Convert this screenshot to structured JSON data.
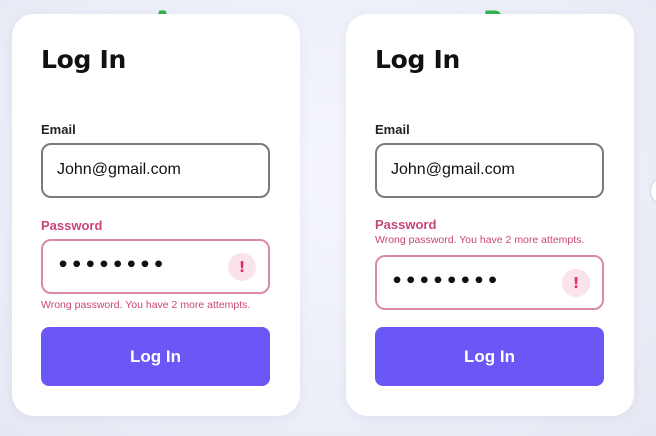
{
  "variants": [
    {
      "tag": "A",
      "title": "Log In",
      "email_label": "Email",
      "email_value": "John@gmail.com",
      "password_label": "Password",
      "password_value": "••••••••",
      "error_icon": "exclamation-icon",
      "error_message": "Wrong password. You have 2 more attempts.",
      "error_position": "below-field",
      "button_label": "Log In"
    },
    {
      "tag": "B",
      "title": "Log In",
      "email_label": "Email",
      "email_value": "John@gmail.com",
      "password_label": "Password",
      "password_value": "••••••••",
      "error_icon": "exclamation-icon",
      "error_message": "Wrong password. You have 2 more attempts.",
      "error_position": "above-field",
      "button_label": "Log In"
    }
  ],
  "colors": {
    "variant_tag": "#2db24a",
    "primary": "#6b57f5",
    "error": "#c9457a",
    "error_border": "#d98aa7",
    "error_icon": "#e0306a",
    "background": "#eceef8"
  }
}
